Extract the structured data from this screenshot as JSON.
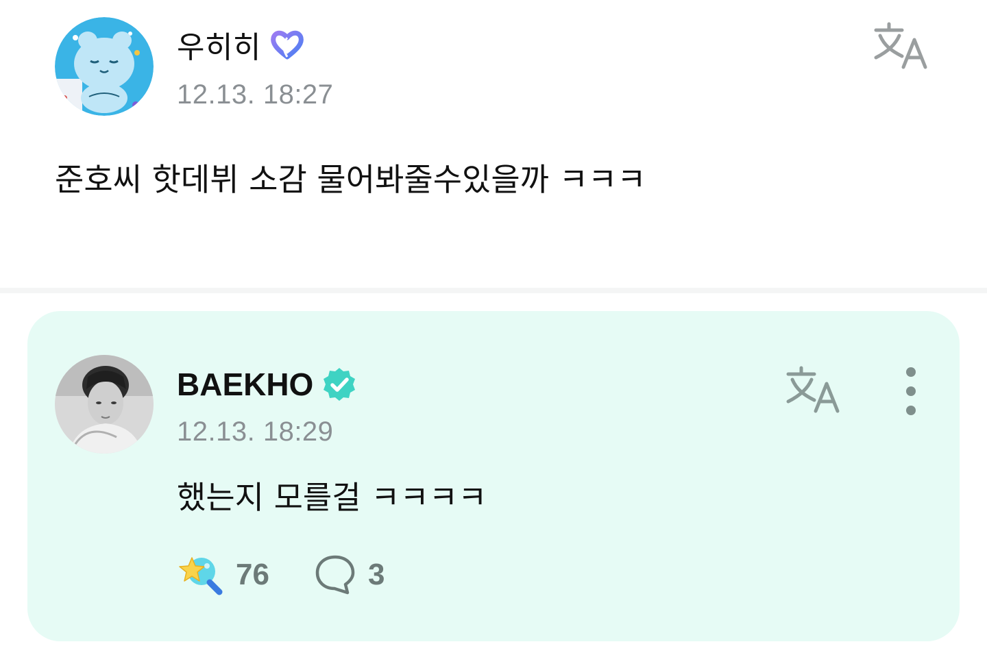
{
  "post": {
    "author": "우히히",
    "badge_icon": "membership-heart-icon",
    "timestamp": "12.13. 18:27",
    "text": "준호씨 핫데뷔 소감 물어봐줄수있을까 ㅋㅋㅋ",
    "translate_icon": "translate-icon"
  },
  "reply": {
    "author": "BAEKHO",
    "badge_icon": "verified-icon",
    "timestamp": "12.13. 18:29",
    "text": "했는지 모를걸 ㅋㅋㅋㅋ",
    "translate_icon": "translate-icon",
    "more_icon": "more-vertical-icon",
    "likes": {
      "icon": "star-wand-icon",
      "count": "76"
    },
    "comments": {
      "icon": "comment-icon",
      "count": "3"
    }
  },
  "colors": {
    "reply_background": "#e6fbf5",
    "verified_badge": "#3fd3c3",
    "timestamp": "#8a8f93",
    "icon_gray": "#8a9a97"
  }
}
